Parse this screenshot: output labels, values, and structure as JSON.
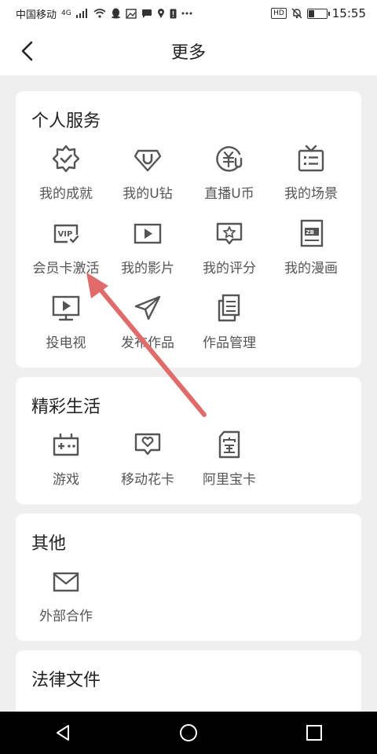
{
  "status": {
    "carrier": "中国移动",
    "network": "4G",
    "time": "15:55",
    "hd": "HD",
    "battery_level": 0.35
  },
  "header": {
    "title": "更多",
    "back_icon": "chevron-left-icon"
  },
  "sections": {
    "personal": {
      "title": "个人服务",
      "items": [
        {
          "label": "我的成就",
          "icon": "achievement-badge-icon"
        },
        {
          "label": "我的U钻",
          "icon": "u-diamond-icon"
        },
        {
          "label": "直播U币",
          "icon": "u-coin-icon"
        },
        {
          "label": "我的场景",
          "icon": "tv-list-icon"
        },
        {
          "label": "会员卡激活",
          "icon": "vip-card-icon"
        },
        {
          "label": "我的影片",
          "icon": "play-video-icon"
        },
        {
          "label": "我的评分",
          "icon": "rating-star-icon"
        },
        {
          "label": "我的漫画",
          "icon": "comic-book-icon"
        },
        {
          "label": "投电视",
          "icon": "cast-tv-icon"
        },
        {
          "label": "发布作品",
          "icon": "send-plane-icon"
        },
        {
          "label": "作品管理",
          "icon": "works-manage-icon"
        }
      ]
    },
    "life": {
      "title": "精彩生活",
      "items": [
        {
          "label": "游戏",
          "icon": "gamepad-icon"
        },
        {
          "label": "移动花卡",
          "icon": "flower-card-icon"
        },
        {
          "label": "阿里宝卡",
          "icon": "ali-card-icon"
        }
      ]
    },
    "other": {
      "title": "其他",
      "items": [
        {
          "label": "外部合作",
          "icon": "mail-icon"
        }
      ]
    },
    "legal": {
      "title": "法律文件"
    }
  },
  "colors": {
    "background": "#efefef",
    "card": "#ffffff",
    "icon": "#555555",
    "annotation_arrow": "#e06b6b",
    "navbar": "#000000"
  },
  "navbar": {
    "back_icon": "nav-back-triangle-icon",
    "home_icon": "nav-home-circle-icon",
    "recents_icon": "nav-recents-square-icon"
  }
}
